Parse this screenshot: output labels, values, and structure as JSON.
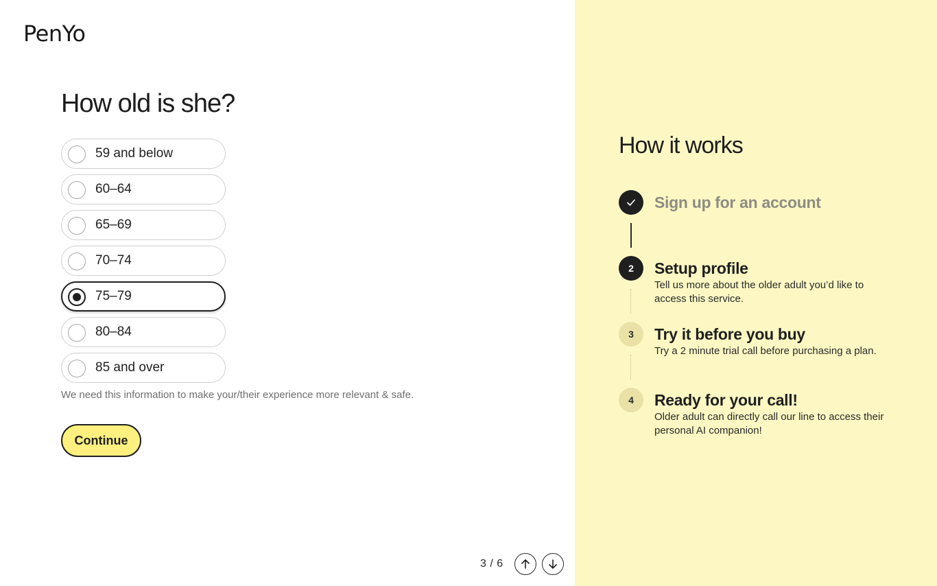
{
  "brand": {
    "logo_text": "PenYo"
  },
  "form": {
    "question": "How old is she?",
    "options": [
      {
        "label": "59 and below",
        "selected": false
      },
      {
        "label": "60–64",
        "selected": false
      },
      {
        "label": "65–69",
        "selected": false
      },
      {
        "label": "70–74",
        "selected": false
      },
      {
        "label": "75–79",
        "selected": true
      },
      {
        "label": "80–84",
        "selected": false
      },
      {
        "label": "85 and over",
        "selected": false
      }
    ],
    "hint": "We need this information to make your/their experience more relevant & safe.",
    "continue_label": "Continue"
  },
  "pager": {
    "text": "3 / 6",
    "up_icon": "arrow-up-icon",
    "down_icon": "arrow-down-icon"
  },
  "how_it_works": {
    "title": "How it works",
    "steps": [
      {
        "marker": "check",
        "title": "Sign up for an account",
        "description": "",
        "state": "done"
      },
      {
        "marker": "2",
        "title": "Setup profile",
        "description": "Tell us more about the older adult you’d like to access this service.",
        "state": "current"
      },
      {
        "marker": "3",
        "title": "Try it before you buy",
        "description": "Try a 2 minute trial call before purchasing a plan.",
        "state": "upcoming"
      },
      {
        "marker": "4",
        "title": "Ready for your call!",
        "description": "Older adult can directly call our line to access their personal AI companion!",
        "state": "upcoming"
      }
    ]
  },
  "colors": {
    "accent_yellow": "#fdf07f",
    "panel_yellow": "#fdf8c3",
    "dark": "#1f1f1f",
    "muted_text": "#8d8c83"
  }
}
